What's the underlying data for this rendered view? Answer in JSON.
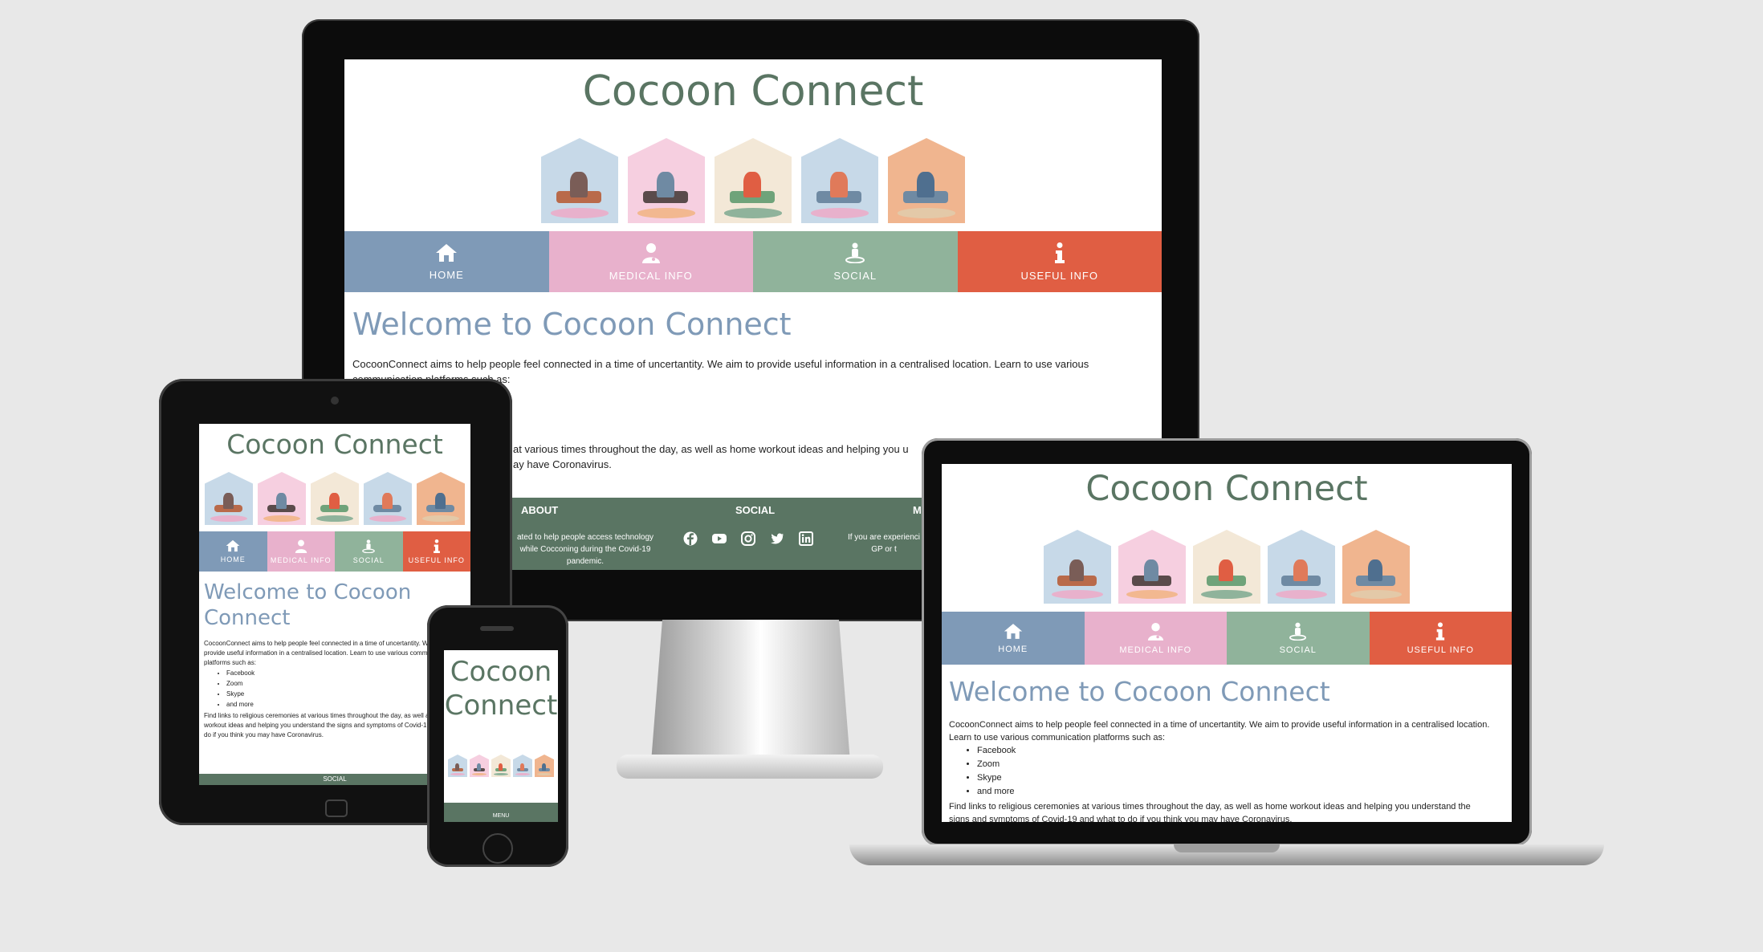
{
  "site": {
    "title": "Cocoon Connect",
    "nav": [
      {
        "label": "HOME",
        "icon": "home-icon"
      },
      {
        "label": "MEDICAL INFO",
        "icon": "user-doctor-icon"
      },
      {
        "label": "SOCIAL",
        "icon": "street-view-icon"
      },
      {
        "label": "USEFUL INFO",
        "icon": "info-icon"
      }
    ],
    "welcome": "Welcome to Cocoon Connect",
    "intro": "CocoonConnect aims to help people feel connected in a time of uncertantity. We aim to provide useful information in a centralised location. Learn to use various communication platforms such as:",
    "platforms": [
      "Facebook",
      "Zoom",
      "Skype",
      "and more"
    ],
    "more": "Find links to religious ceremonies at various times throughout the day, as well as home workout ideas and helping you understand the signs and symptoms of Covid-19 and what to do if you think you may have Coronavirus.",
    "footer": {
      "about_heading": "ABOUT",
      "social_heading": "SOCIAL",
      "more_heading": "M",
      "about_text": "ated to help people access technology while Cocconing during the Covid-19 pandemic.",
      "more_text": "If you are experienci GP or t",
      "social_icons": [
        "facebook-icon",
        "youtube-icon",
        "instagram-icon",
        "twitter-icon",
        "linkedin-icon"
      ],
      "tablet_heading": "SOCIAL",
      "phone_heading": "MENU"
    },
    "monitor_visible": {
      "partial_more_1": "at various times throughout the day, as well as home workout ideas and helping you u",
      "partial_more_2": "ay have Coronavirus."
    },
    "laptop_visible": {
      "more_1": "Find links to religious ceremonies at various times throughout the day, as well as home workout ideas and helping you understand the",
      "more_2": "signs and symptoms of Covid-19 and what to do if you think you may have Coronavirus."
    }
  },
  "colors": {
    "background": "#e8e8e8",
    "brand_green": "#5a7563",
    "nav_blue": "#7f9ab7",
    "nav_pink": "#e8b1cc",
    "nav_green": "#90b39b",
    "nav_orange": "#e05e43"
  },
  "houses": [
    {
      "bg": "#c7d9e8",
      "figure": "#7a5d57",
      "seat": "#b96a4a",
      "rug": "#e8b1cc"
    },
    {
      "bg": "#f6cfe0",
      "figure": "#6f8aa3",
      "seat": "#5a4b4b",
      "rug": "#f2b890"
    },
    {
      "bg": "#f3e8d7",
      "figure": "#e05e43",
      "seat": "#6fa37a",
      "rug": "#8fb39b"
    },
    {
      "bg": "#c7d9e8",
      "figure": "#e07a5a",
      "seat": "#6f8aa3",
      "rug": "#e8b1cc"
    },
    {
      "bg": "#f0b58f",
      "figure": "#4f6f8f",
      "seat": "#6f8aa3",
      "rug": "#e3c9a8"
    }
  ]
}
